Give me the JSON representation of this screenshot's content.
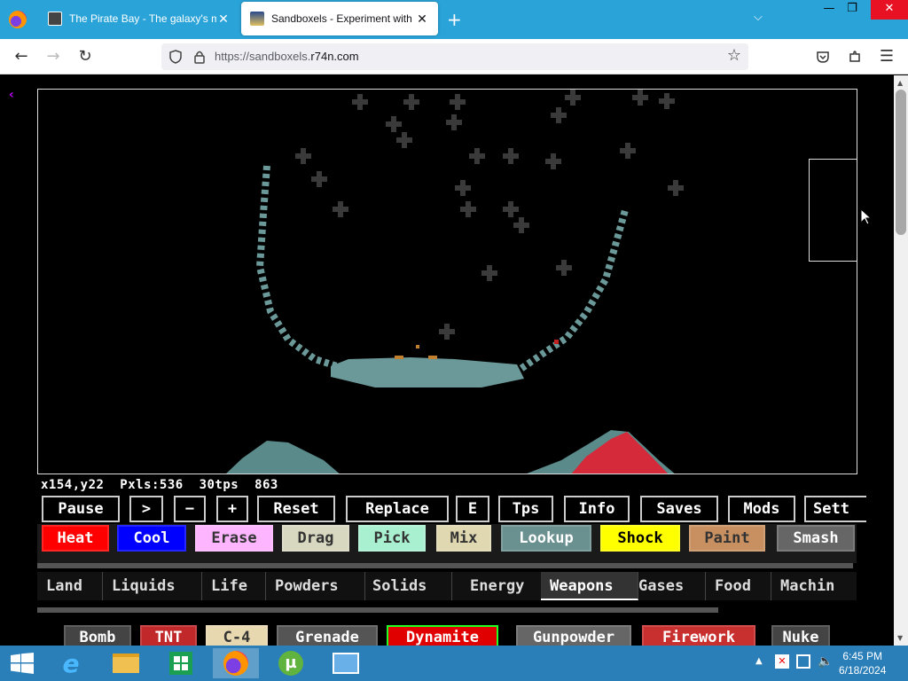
{
  "browser": {
    "tabs": [
      {
        "title": "The Pirate Bay - The galaxy's m",
        "active": false
      },
      {
        "title": "Sandboxels - Experiment with P",
        "active": true
      }
    ],
    "url_prefix": "https://sandboxels.",
    "url_domain": "r74n.com"
  },
  "game": {
    "stats": "x154,y22  Pxls:536  30tps  863",
    "controls": [
      "Pause",
      ">",
      "−",
      "+",
      "Reset",
      "Replace",
      "E",
      "Tps",
      "Info",
      "Saves",
      "Mods",
      "Sett"
    ],
    "tools": [
      {
        "label": "Heat",
        "color": "#ff0000"
      },
      {
        "label": "Cool",
        "color": "#0000ff"
      },
      {
        "label": "Erase",
        "color": "#fdb5ff"
      },
      {
        "label": "Drag",
        "color": "#d8d8c0"
      },
      {
        "label": "Pick",
        "color": "#a8f0d0"
      },
      {
        "label": "Mix",
        "color": "#e0d8b0"
      },
      {
        "label": "Lookup",
        "color": "#6b9090"
      },
      {
        "label": "Shock",
        "color": "#ffff00"
      },
      {
        "label": "Paint",
        "color": "#c89060"
      },
      {
        "label": "Smash",
        "color": "#666666"
      }
    ],
    "categories": [
      "Land",
      "Liquids",
      "Life",
      "Powders",
      "Solids",
      "Energy",
      "Weapons",
      "Gases",
      "Food",
      "Machin"
    ],
    "selected_category": "Weapons",
    "elements": [
      {
        "label": "Bomb",
        "color": "#444444"
      },
      {
        "label": "TNT",
        "color": "#c0282a"
      },
      {
        "label": "C-4",
        "color": "#e8d8b0"
      },
      {
        "label": "Grenade",
        "color": "#555555"
      },
      {
        "label": "Dynamite",
        "color": "#e00000"
      },
      {
        "label": "Gunpowder",
        "color": "#666666"
      },
      {
        "label": "Firework",
        "color": "#c83030"
      },
      {
        "label": "Nuke",
        "color": "#444444"
      }
    ]
  },
  "taskbar": {
    "time": "6:45 PM",
    "date": "6/18/2024"
  }
}
